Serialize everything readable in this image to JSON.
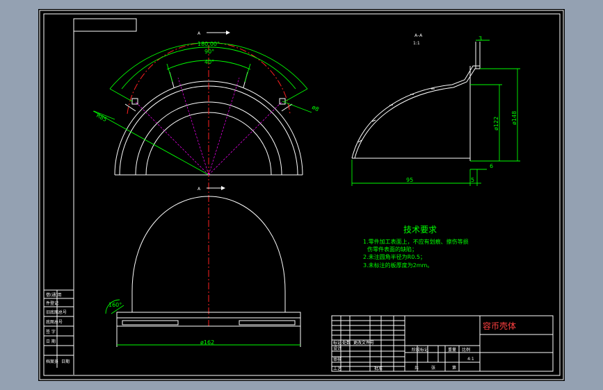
{
  "scale_note": "1:1",
  "dimensions": {
    "angle_outer": "180.00°",
    "angle_mid": "90°",
    "angle_inner": "40°",
    "radius_left": "R85",
    "hole_dia": "ø8",
    "top_thickness": "3",
    "dia_122": "ø122",
    "dia_148": "ø148",
    "bottom_offset": "6",
    "width_95": "95",
    "width_5": "5",
    "base_angle": "160°",
    "base_dia": "ø162"
  },
  "tech_requirements": {
    "title": "技术要求",
    "items": [
      "1.零件加工表面上，不应有划痕、擦伤等损",
      "伤零件表面的缺陷；",
      "2.未注圆角半径为R0.5；",
      "3.未标注的板厚度为2mm。"
    ]
  },
  "title_block": {
    "part_name": "容币壳体",
    "scale_value": "4:1",
    "cells": {
      "c1": "标记",
      "c2": "处数",
      "c3": "更改文件号",
      "c4": "设计",
      "c5": "审核",
      "c6": "工艺",
      "c7": "阶段标记",
      "c8": "重量",
      "c9": "比例",
      "c10": "共",
      "c11": "张",
      "c12": "第",
      "c13": "批准"
    }
  },
  "side_column": {
    "labels": [
      "借(通)用",
      "件登记",
      "旧底图总号",
      "底图总号",
      "签 字",
      "日 期",
      "档案员",
      "日期"
    ]
  }
}
